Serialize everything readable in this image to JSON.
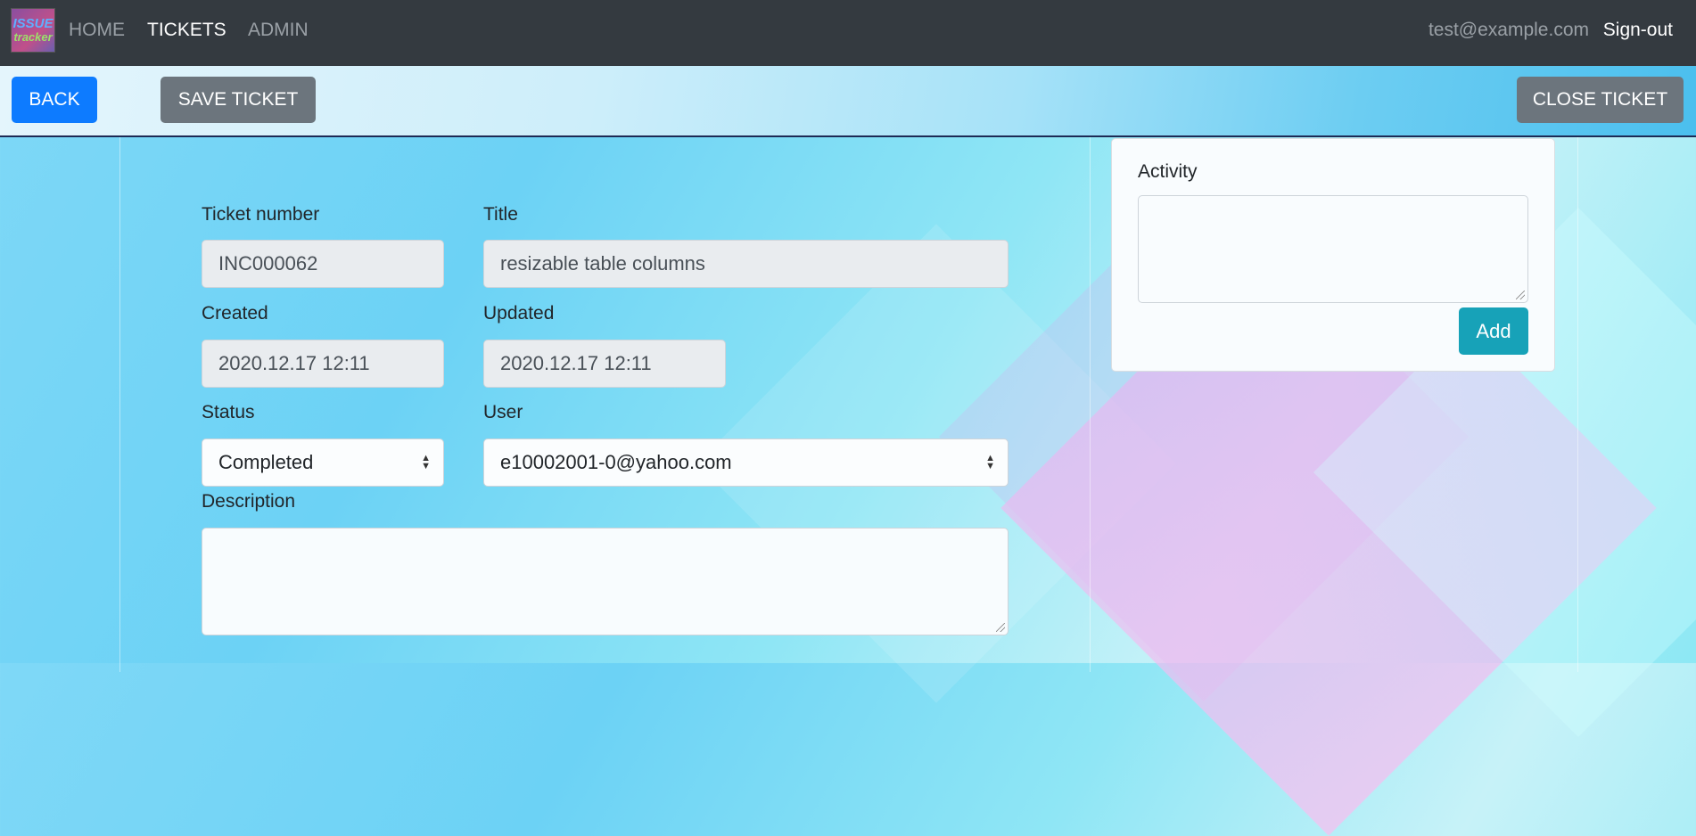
{
  "navbar": {
    "logo_line1": "ISSUE",
    "logo_line2": "tracker",
    "links": [
      {
        "label": "HOME",
        "active": false
      },
      {
        "label": "TICKETS",
        "active": true
      },
      {
        "label": "ADMIN",
        "active": false
      }
    ],
    "user_email": "test@example.com",
    "signout_label": "Sign-out"
  },
  "toolbar": {
    "back_label": "BACK",
    "save_label": "SAVE TICKET",
    "close_label": "CLOSE TICKET"
  },
  "form": {
    "ticket_number": {
      "label": "Ticket number",
      "value": "INC000062"
    },
    "title": {
      "label": "Title",
      "value": "resizable table columns"
    },
    "created": {
      "label": "Created",
      "value": "2020.12.17 12:11"
    },
    "updated": {
      "label": "Updated",
      "value": "2020.12.17 12:11"
    },
    "status": {
      "label": "Status",
      "value": "Completed"
    },
    "user": {
      "label": "User",
      "value": "e10002001-0@yahoo.com"
    },
    "description": {
      "label": "Description",
      "value": ""
    }
  },
  "activity": {
    "label": "Activity",
    "value": "",
    "add_label": "Add"
  },
  "colors": {
    "navbar": "#343a40",
    "primary": "#0d7bff",
    "secondary": "#6c757d",
    "info": "#17a2b8"
  }
}
